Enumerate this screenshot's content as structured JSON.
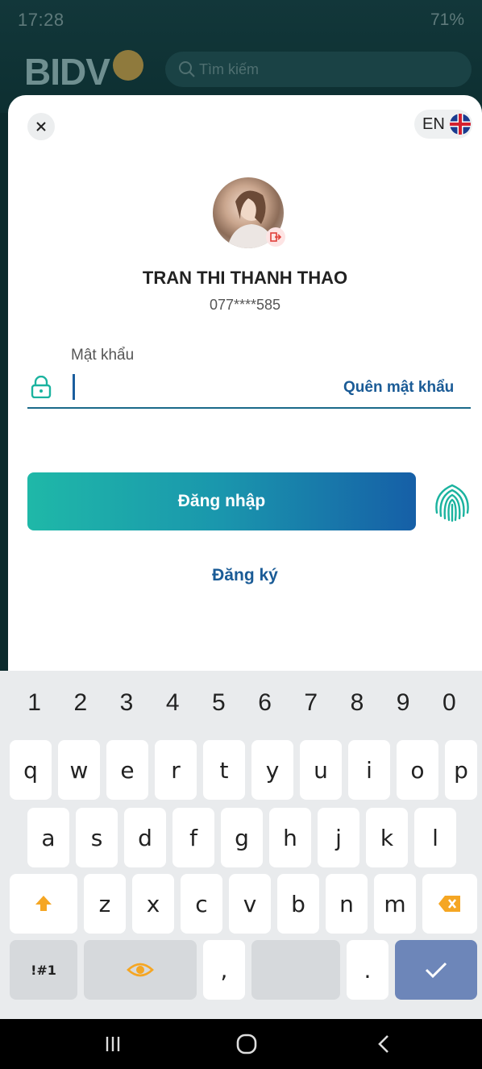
{
  "status_bar": {
    "time": "17:28",
    "battery": "71%"
  },
  "background_app": {
    "logo": "BIDV",
    "search_placeholder": "Tìm kiếm"
  },
  "header": {
    "close_icon": "close-icon",
    "language_label": "EN"
  },
  "profile": {
    "name": "TRAN THI THANH THAO",
    "phone": "077****585"
  },
  "password": {
    "label": "Mật khẩu",
    "value": "",
    "forgot_label": "Quên mật khẩu"
  },
  "actions": {
    "login_label": "Đăng nhập",
    "register_label": "Đăng ký"
  },
  "colors": {
    "accent": "#1a5b96",
    "gradient_start": "#1fb8a8",
    "gradient_end": "#165fa7"
  },
  "keyboard": {
    "numbers": [
      "1",
      "2",
      "3",
      "4",
      "5",
      "6",
      "7",
      "8",
      "9",
      "0"
    ],
    "row1": [
      "q",
      "w",
      "e",
      "r",
      "t",
      "y",
      "u",
      "i",
      "o",
      "p"
    ],
    "row2": [
      "a",
      "s",
      "d",
      "f",
      "g",
      "h",
      "j",
      "k",
      "l"
    ],
    "row3": [
      "z",
      "x",
      "c",
      "v",
      "b",
      "n",
      "m"
    ],
    "symbols_label": "!#1",
    "comma": ",",
    "period": "."
  }
}
